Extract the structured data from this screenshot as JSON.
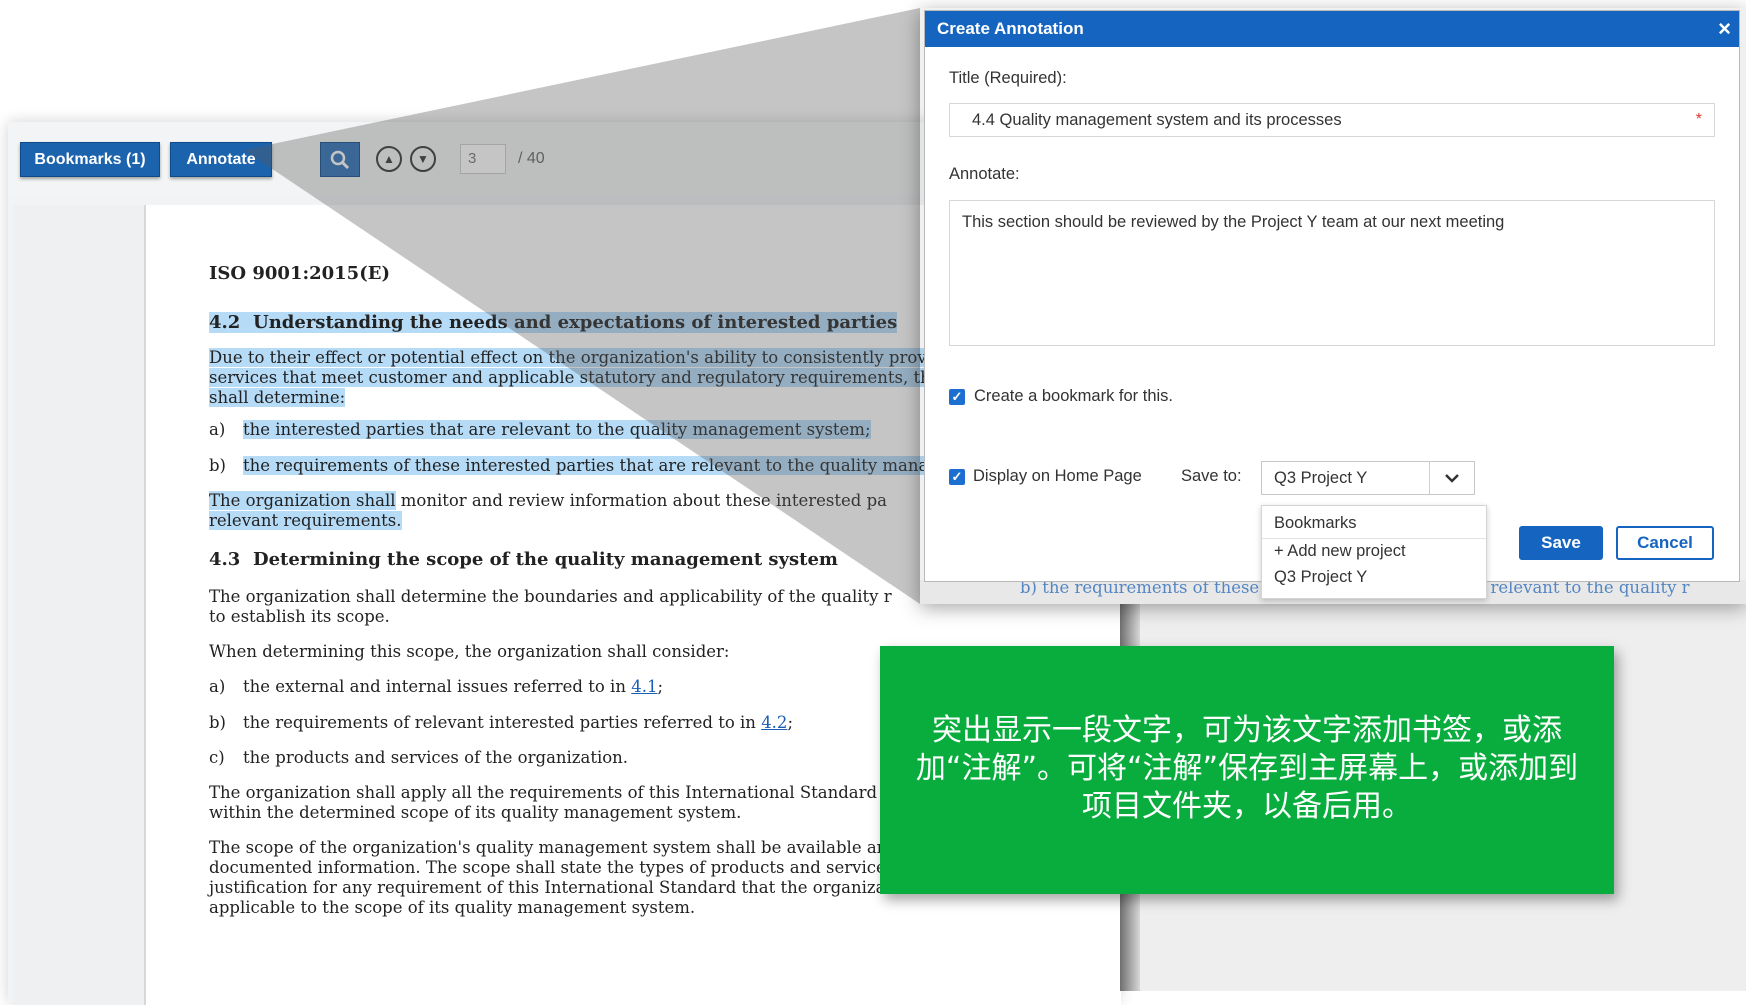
{
  "toolbar": {
    "bookmarks_label": "Bookmarks (1)",
    "annotate_label": "Annotate",
    "page_current": "3",
    "page_total": "/ 40"
  },
  "document": {
    "standard": "ISO 9001:2015(E)",
    "section_42": {
      "number": "4.2",
      "heading": "Understanding the needs and expectations of interested parties",
      "intro_lines": [
        "Due to their effect or potential effect on the organization's ability to consistently provid",
        "services that meet customer and applicable statutory and regulatory requirements, th",
        "shall determine:"
      ],
      "item_a_label": "a)",
      "item_a": "the interested parties that are relevant to the quality management system;",
      "item_b_label": "b)",
      "item_b": "the requirements of these interested parties that are relevant to the quality manage",
      "monitor_hl": "The organization shall",
      "monitor_rest": " monitor and review information about these interested pa",
      "monitor_line2": "relevant requirements."
    },
    "section_43": {
      "number": "4.3",
      "heading": "Determining the scope of the quality management system",
      "p1_lines": [
        "The organization shall determine the boundaries and applicability of the quality r",
        "to establish its scope."
      ],
      "p2": "When determining this scope, the organization shall consider:",
      "items": [
        {
          "label": "a)",
          "text": "the external and internal issues referred to in ",
          "ref": "4.1",
          "after": ";"
        },
        {
          "label": "b)",
          "text": "the requirements of relevant interested parties referred to in ",
          "ref": "4.2",
          "after": ";"
        },
        {
          "label": "c)",
          "text": "the products and services of the organization.",
          "ref": "",
          "after": ""
        }
      ],
      "p3_lines": [
        "The organization shall apply all the requirements of this International Standard if",
        "within the determined scope of its quality management system."
      ],
      "p4_lines": [
        "The scope of the organization's quality management system shall be available and be maintained as",
        "documented information. The scope shall state the types of products and services covered, and provide",
        "justification for any requirement of this International Standard that the organization determines is not",
        "applicable to the scope of its quality management system."
      ]
    },
    "behind_line": "b)   the requirements of these interested parties that are relevant to the quality r"
  },
  "dialog": {
    "title": "Create Annotation",
    "close_glyph": "×",
    "title_label": "Title (Required):",
    "title_value": "4.4 Quality management system and its processes",
    "required_star": "*",
    "annotate_label": "Annotate:",
    "annotate_value": "This section should be reviewed by the Project Y team at our next meeting",
    "bookmark_checkbox_label": "Create a bookmark for this.",
    "bookmark_checked": true,
    "home_checkbox_label": "Display on Home Page",
    "home_checked": true,
    "save_to_label": "Save to:",
    "save_to_value": "Q3 Project Y",
    "dropdown_options": [
      "Bookmarks",
      "+ Add new project",
      "Q3 Project Y"
    ],
    "save_label": "Save",
    "cancel_label": "Cancel"
  },
  "callout": {
    "text": "突出显示一段文字，可为该文字添加书签，或添加“注解”。可将“注解”保存到主屏幕上，或添加到项目文件夹，以备后用。",
    "color": "#08ad3e"
  },
  "colors": {
    "accent": "#1565c0",
    "highlight": "#78bef0"
  }
}
